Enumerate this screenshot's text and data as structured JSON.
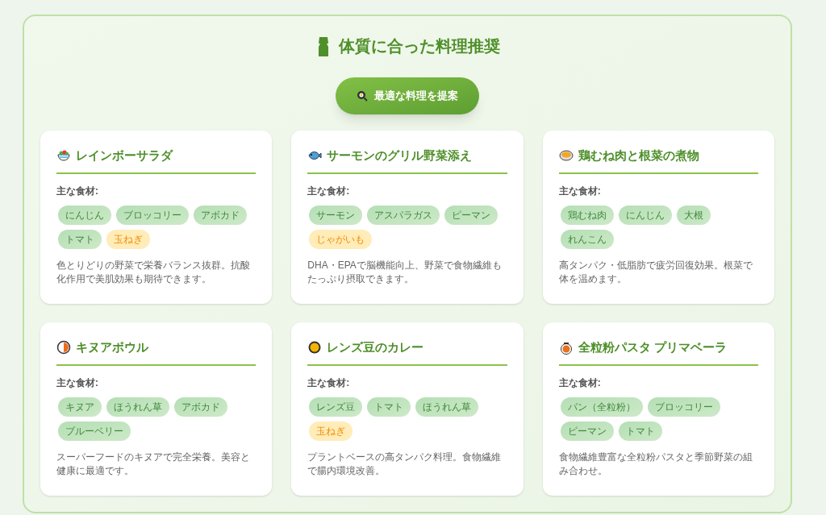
{
  "header": {
    "title": "体質に合った料理推奨",
    "button": "最適な料理を提案"
  },
  "recipes": [
    {
      "title": "レインボーサラダ",
      "ingredients_label": "主な食材:",
      "ingredients": [
        {
          "name": "にんじん",
          "kind": "normal"
        },
        {
          "name": "ブロッコリー",
          "kind": "normal"
        },
        {
          "name": "アボカド",
          "kind": "normal"
        },
        {
          "name": "トマト",
          "kind": "normal"
        },
        {
          "name": "玉ねぎ",
          "kind": "caution"
        }
      ],
      "description": "色とりどりの野菜で栄養バランス抜群。抗酸化作用で美肌効果も期待できます。"
    },
    {
      "title": "サーモンのグリル野菜添え",
      "ingredients_label": "主な食材:",
      "ingredients": [
        {
          "name": "サーモン",
          "kind": "normal"
        },
        {
          "name": "アスパラガス",
          "kind": "normal"
        },
        {
          "name": "ピーマン",
          "kind": "normal"
        },
        {
          "name": "じゃがいも",
          "kind": "caution"
        }
      ],
      "description": "DHA・EPAで脳機能向上、野菜で食物繊維もたっぷり摂取できます。"
    },
    {
      "title": "鶏むね肉と根菜の煮物",
      "ingredients_label": "主な食材:",
      "ingredients": [
        {
          "name": "鶏むね肉",
          "kind": "normal"
        },
        {
          "name": "にんじん",
          "kind": "normal"
        },
        {
          "name": "大根",
          "kind": "normal"
        },
        {
          "name": "れんこん",
          "kind": "normal"
        }
      ],
      "description": "高タンパク・低脂肪で疲労回復効果。根菜で体を温めます。"
    },
    {
      "title": "キヌアボウル",
      "ingredients_label": "主な食材:",
      "ingredients": [
        {
          "name": "キヌア",
          "kind": "normal"
        },
        {
          "name": "ほうれん草",
          "kind": "normal"
        },
        {
          "name": "アボカド",
          "kind": "normal"
        },
        {
          "name": "ブルーベリー",
          "kind": "normal"
        }
      ],
      "description": "スーパーフードのキヌアで完全栄養。美容と健康に最適です。"
    },
    {
      "title": "レンズ豆のカレー",
      "ingredients_label": "主な食材:",
      "ingredients": [
        {
          "name": "レンズ豆",
          "kind": "normal"
        },
        {
          "name": "トマト",
          "kind": "normal"
        },
        {
          "name": "ほうれん草",
          "kind": "normal"
        },
        {
          "name": "玉ねぎ",
          "kind": "caution"
        }
      ],
      "description": "プラントベースの高タンパク料理。食物繊維で腸内環境改善。"
    },
    {
      "title": "全粒粉パスタ プリマベーラ",
      "ingredients_label": "主な食材:",
      "ingredients": [
        {
          "name": "パン（全粒粉）",
          "kind": "normal"
        },
        {
          "name": "ブロッコリー",
          "kind": "normal"
        },
        {
          "name": "ピーマン",
          "kind": "normal"
        },
        {
          "name": "トマト",
          "kind": "normal"
        }
      ],
      "description": "食物繊維豊富な全粒粉パスタと季節野菜の組み合わせ。"
    }
  ]
}
